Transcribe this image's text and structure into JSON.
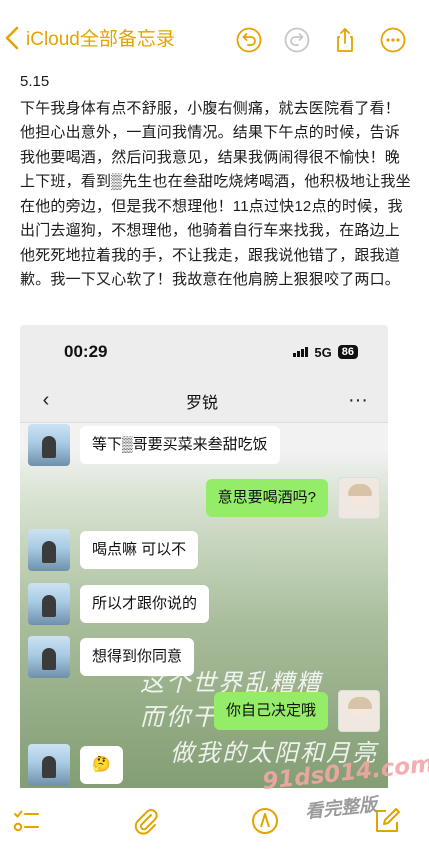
{
  "nav": {
    "back_label": "iCloud全部备忘录",
    "accent_color": "#e3a400",
    "icons": [
      "undo-icon",
      "redo-icon",
      "share-icon",
      "more-icon"
    ]
  },
  "note": {
    "date": "5.15",
    "body": "下午我身体有点不舒服，小腹右侧痛，就去医院看了看！他担心出意外，一直问我情况。结果下午点的时候，告诉我他要喝酒，然后问我意见，结果我俩闹得很不愉快！晚上下班，看到▒先生也在叁甜吃烧烤喝酒，他积极地让我坐在他的旁边，但是我不想理他！11点过快12点的时候，我出门去遛狗，不想理他，他骑着自行车来找我，在路边上他死死地拉着我的手，不让我走，跟我说他错了，跟我道歉。我一下又心软了！我故意在他肩膀上狠狠咬了两口。"
  },
  "embedded_chat": {
    "status_time": "00:29",
    "network": "5G",
    "battery": "86",
    "contact_name": "罗锐",
    "more_label": "···",
    "messages": [
      {
        "side": "left",
        "text": "等下▒哥要买菜来叁甜吃饭"
      },
      {
        "side": "right",
        "text": "意思要喝酒吗?"
      },
      {
        "side": "left",
        "text": "喝点嘛 可以不"
      },
      {
        "side": "left",
        "text": "所以才跟你说的"
      },
      {
        "side": "left",
        "text": "想得到你同意"
      },
      {
        "side": "right",
        "text": "你自己决定哦"
      },
      {
        "side": "left",
        "text": "🤔"
      }
    ],
    "wallpaper_lines": [
      "这个世界乱糟糟",
      "而你干干净净",
      "做我的太阳和月亮"
    ]
  },
  "toolbar": {
    "icons": [
      "checklist-icon",
      "attachment-icon",
      "markup-icon",
      "compose-icon"
    ]
  },
  "watermark": {
    "url": "91ds014.com",
    "text": "看完整版"
  }
}
